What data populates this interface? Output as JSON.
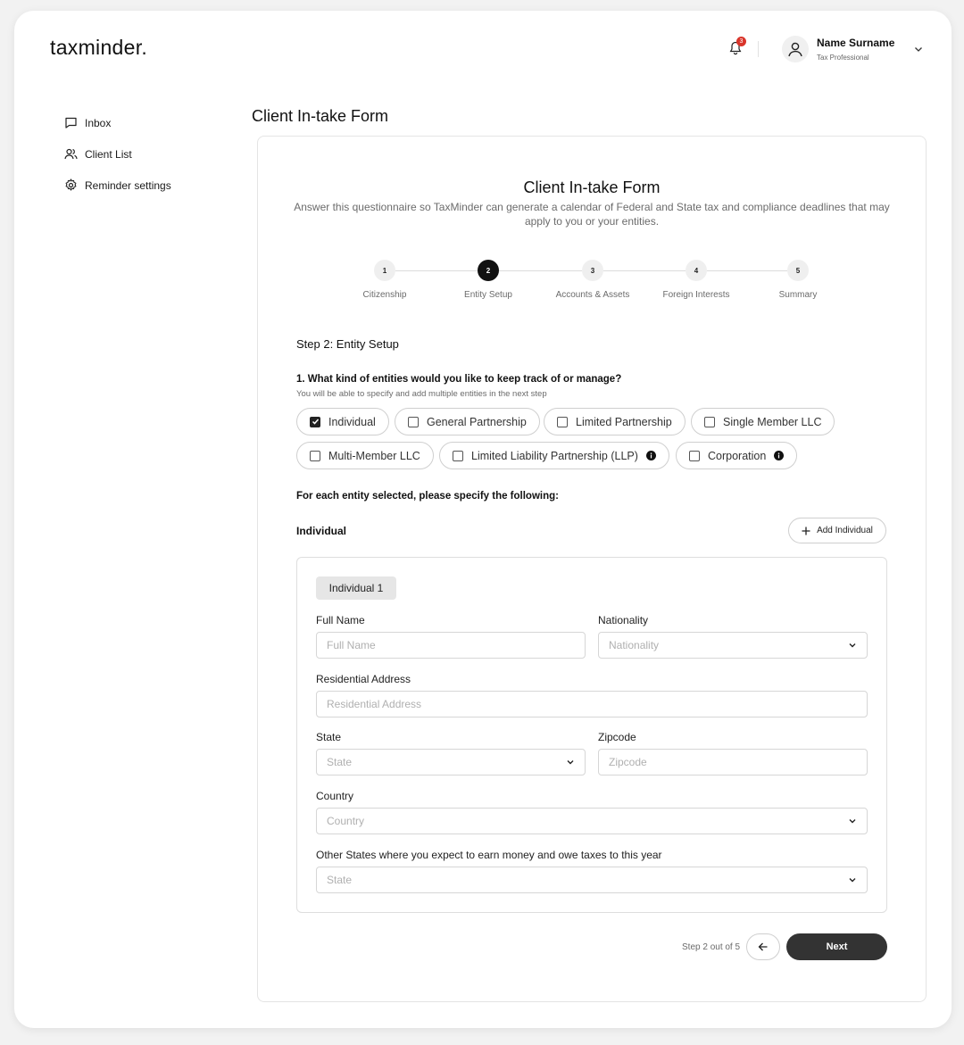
{
  "header": {
    "logo": "taxminder.",
    "notification_count": "3",
    "user_name": "Name Surname",
    "user_role": "Tax Professional"
  },
  "sidebar": {
    "items": [
      {
        "label": "Inbox",
        "icon": "message-icon"
      },
      {
        "label": "Client List",
        "icon": "users-icon"
      },
      {
        "label": "Reminder settings",
        "icon": "gear-icon"
      }
    ]
  },
  "page_title": "Client In-take Form",
  "form": {
    "title": "Client In-take Form",
    "subtitle": "Answer this questionnaire so TaxMinder can generate a calendar of Federal and State tax and compliance deadlines that may apply to you or your entities.",
    "steps": [
      {
        "number": "1",
        "label": "Citizenship"
      },
      {
        "number": "2",
        "label": "Entity Setup"
      },
      {
        "number": "3",
        "label": "Accounts & Assets"
      },
      {
        "number": "4",
        "label": "Foreign Interests"
      },
      {
        "number": "5",
        "label": "Summary"
      }
    ],
    "active_step": 2,
    "step_heading": "Step 2: Entity Setup",
    "question1": "1. What kind of entities would you like to keep track of or manage?",
    "question1_sub": "You will be able to specify and add multiple entities in the next step",
    "entity_options": [
      {
        "label": "Individual",
        "checked": true
      },
      {
        "label": "General Partnership",
        "checked": false
      },
      {
        "label": "Limited Partnership",
        "checked": false
      },
      {
        "label": "Single Member LLC",
        "checked": false
      },
      {
        "label": "Multi-Member LLC",
        "checked": false
      },
      {
        "label": "Limited Liability Partnership (LLP)",
        "checked": false
      },
      {
        "label": "Corporation",
        "checked": false
      }
    ],
    "each_entity_label": "For each entity selected, please specify the following:",
    "individual_section_label": "Individual",
    "add_individual_label": "Add Individual",
    "individual_tab": "Individual 1",
    "fields": {
      "full_name_label": "Full Name",
      "full_name_placeholder": "Full Name",
      "nationality_label": "Nationality",
      "nationality_placeholder": "Nationality",
      "address_label": "Residential Address",
      "address_placeholder": "Residential Address",
      "state_label": "State",
      "state_placeholder": "State",
      "zipcode_label": "Zipcode",
      "zipcode_placeholder": "Zipcode",
      "country_label": "Country",
      "country_placeholder": "Country",
      "other_states_label": "Other States where you expect to earn money and owe taxes to this year",
      "other_states_placeholder": "State"
    },
    "footer": {
      "step_text": "Step 2 out of 5",
      "next_label": "Next"
    }
  },
  "colors": {
    "notification_badge": "#d9352b",
    "primary_button": "#333333",
    "active_step": "#111111"
  }
}
